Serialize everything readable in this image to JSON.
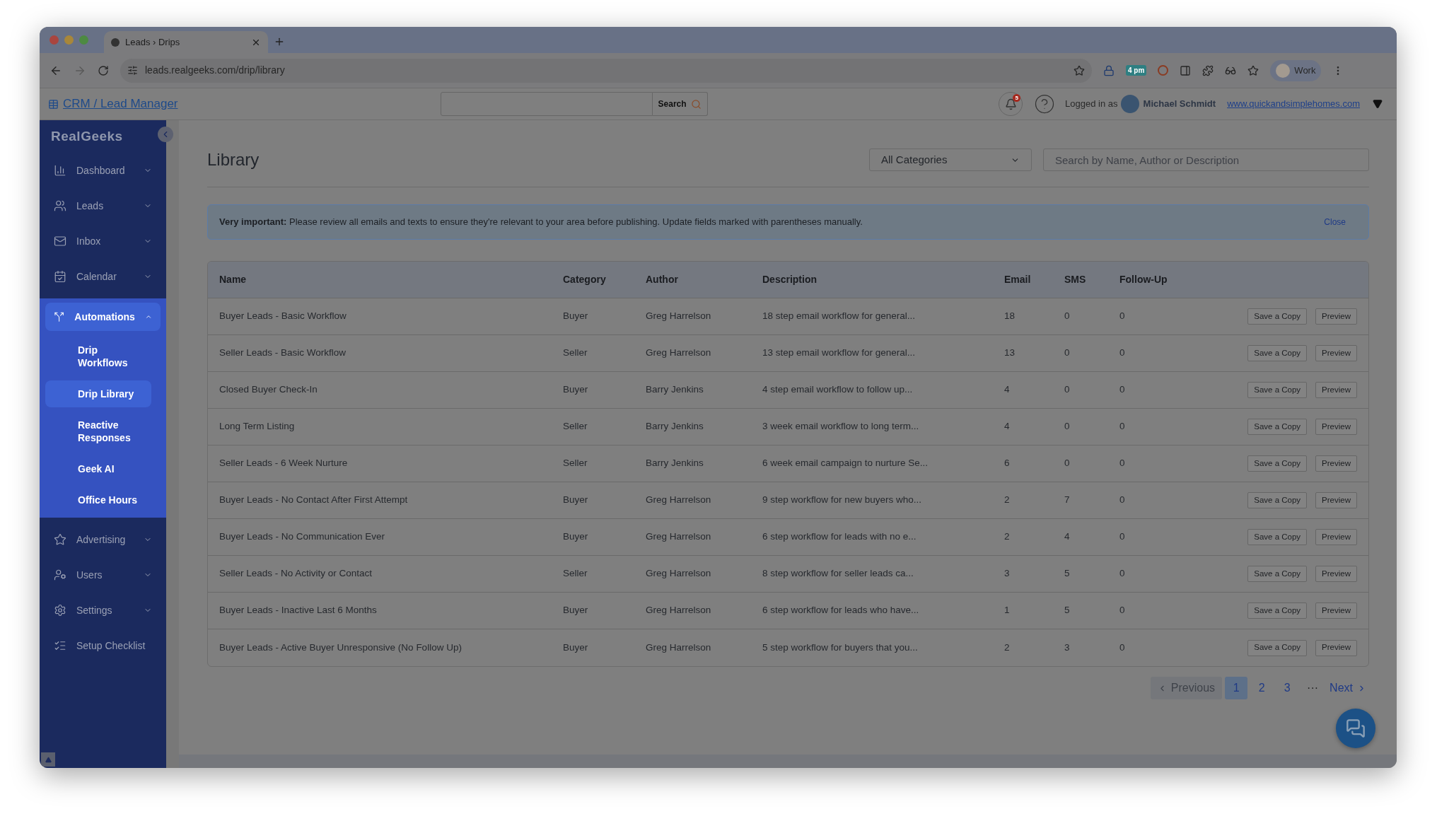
{
  "browser": {
    "tab_title": "Leads › Drips",
    "url": "leads.realgeeks.com/drip/library",
    "extension_badge": "4 pm",
    "profile": "Work"
  },
  "app_header": {
    "title": "CRM / Lead Manager",
    "search": {
      "button": "Search"
    },
    "notification_count": "5",
    "logged_in_label": "Logged in as",
    "user_name": "Michael Schmidt",
    "site_link": "www.quickandsimplehomes.com"
  },
  "sidebar": {
    "logo": "RealGeeks",
    "items": [
      {
        "label": "Dashboard",
        "selected": false,
        "expanded": false
      },
      {
        "label": "Leads",
        "selected": false,
        "expanded": false
      },
      {
        "label": "Inbox",
        "selected": false,
        "expanded": false
      },
      {
        "label": "Calendar",
        "selected": false,
        "expanded": false
      },
      {
        "label": "Automations",
        "selected": true,
        "expanded": true,
        "children": [
          {
            "label": "Drip Workflows",
            "selected": false
          },
          {
            "label": "Drip Library",
            "selected": true
          },
          {
            "label": "Reactive Responses",
            "selected": false
          },
          {
            "label": "Geek AI",
            "selected": false
          },
          {
            "label": "Office Hours",
            "selected": false
          }
        ]
      },
      {
        "label": "Advertising",
        "selected": false,
        "expanded": false
      },
      {
        "label": "Users",
        "selected": false,
        "expanded": false
      },
      {
        "label": "Settings",
        "selected": false,
        "expanded": false
      },
      {
        "label": "Setup Checklist",
        "selected": false
      }
    ]
  },
  "page": {
    "title": "Library",
    "category_filter": "All Categories",
    "search": {
      "placeholder": "Search by Name, Author or Description"
    }
  },
  "banner": {
    "text": "**Very important:** Please review all emails and texts to ensure they're relevant to your area before publishing. Update fields marked with parentheses manually.",
    "close": "Close"
  },
  "table": {
    "columns": [
      "Name",
      "Category",
      "Author",
      "Description",
      "Email",
      "SMS",
      "Follow-Up"
    ],
    "rows": [
      {
        "cells": [
          "Buyer Leads - Basic Workflow",
          "Buyer",
          "Greg Harrelson",
          "18 step email workflow for general...",
          "18",
          "0",
          "0"
        ],
        "actions": [
          "Save a Copy",
          "Preview"
        ]
      },
      {
        "cells": [
          "Seller Leads - Basic Workflow",
          "Seller",
          "Greg Harrelson",
          "13 step email workflow for general...",
          "13",
          "0",
          "0"
        ],
        "actions": [
          "Save a Copy",
          "Preview"
        ]
      },
      {
        "cells": [
          "Closed Buyer Check-In",
          "Buyer",
          "Barry Jenkins",
          "4 step email workflow to follow up...",
          "4",
          "0",
          "0"
        ],
        "actions": [
          "Save a Copy",
          "Preview"
        ]
      },
      {
        "cells": [
          "Long Term Listing",
          "Seller",
          "Barry Jenkins",
          "3 week email workflow to long term...",
          "4",
          "0",
          "0"
        ],
        "actions": [
          "Save a Copy",
          "Preview"
        ]
      },
      {
        "cells": [
          "Seller Leads - 6 Week Nurture",
          "Seller",
          "Barry Jenkins",
          "6 week email campaign to nurture Se...",
          "6",
          "0",
          "0"
        ],
        "actions": [
          "Save a Copy",
          "Preview"
        ]
      },
      {
        "cells": [
          "Buyer Leads - No Contact After First Attempt",
          "Buyer",
          "Greg Harrelson",
          "9 step workflow for new buyers who...",
          "2",
          "7",
          "0"
        ],
        "actions": [
          "Save a Copy",
          "Preview"
        ]
      },
      {
        "cells": [
          "Buyer Leads - No Communication Ever",
          "Buyer",
          "Greg Harrelson",
          "6 step workflow for leads with no e...",
          "2",
          "4",
          "0"
        ],
        "actions": [
          "Save a Copy",
          "Preview"
        ]
      },
      {
        "cells": [
          "Seller Leads - No Activity or Contact",
          "Seller",
          "Greg Harrelson",
          "8 step workflow for seller leads ca...",
          "3",
          "5",
          "0"
        ],
        "actions": [
          "Save a Copy",
          "Preview"
        ]
      },
      {
        "cells": [
          "Buyer Leads - Inactive Last 6 Months",
          "Buyer",
          "Greg Harrelson",
          "6 step workflow for leads who have...",
          "1",
          "5",
          "0"
        ],
        "actions": [
          "Save a Copy",
          "Preview"
        ]
      },
      {
        "cells": [
          "Buyer Leads - Active Buyer Unresponsive (No Follow Up)",
          "Buyer",
          "Greg Harrelson",
          "5 step workflow for buyers that you...",
          "2",
          "3",
          "0"
        ],
        "actions": [
          "Save a Copy",
          "Preview"
        ]
      }
    ]
  },
  "pagination": {
    "previous": {
      "label": "Previous",
      "disabled": true
    },
    "pages": [
      {
        "label": "1",
        "selected": true
      },
      {
        "label": "2",
        "selected": false
      },
      {
        "label": "3",
        "selected": false
      }
    ],
    "ellipsis": "···",
    "next": {
      "label": "Next",
      "disabled": false
    }
  }
}
